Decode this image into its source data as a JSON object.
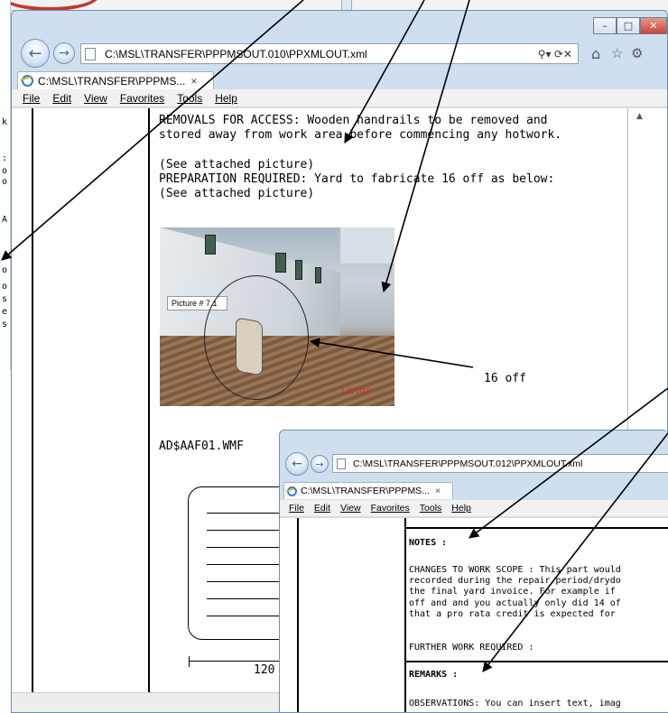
{
  "background": {
    "left_fragments": [
      "k",
      ":",
      "o",
      "o",
      "A",
      "o",
      "o",
      "s",
      "e",
      "s"
    ]
  },
  "window1": {
    "address": "C:\\MSL\\TRANSFER\\PPPMSOUT.010\\PPXMLOUT.xml",
    "search_icon": "search-dropdown-icon",
    "tab_title": "C:\\MSL\\TRANSFER\\PPPMS...",
    "tab_close": "×",
    "menu": [
      "File",
      "Edit",
      "View",
      "Favorites",
      "Tools",
      "Help"
    ],
    "doc_lines": [
      "REMOVALS FOR ACCESS: Wooden handrails to be removed and",
      "stored away from work area before commencing any hotwork.",
      "",
      "(See attached picture)",
      "PREPARATION REQUIRED: Yard to fabricate 16 off as below:",
      "(See attached picture)"
    ],
    "picture_label": "Picture # 7.1",
    "picture_date": "7 11 2007",
    "callout": "16 off",
    "image_filename": "AD$AAF01.WMF",
    "dimension_label": "120"
  },
  "window2": {
    "address": "C:\\MSL\\TRANSFER\\PPPMSOUT.012\\PPXMLOUT.xml",
    "tab_title": "C:\\MSL\\TRANSFER\\PPPMS...",
    "tab_close": "×",
    "menu": [
      "File",
      "Edit",
      "View",
      "Favorites",
      "Tools",
      "Help"
    ],
    "notes_heading": "NOTES :",
    "changes_lines": [
      "CHANGES TO WORK SCOPE : This part would",
      "recorded during the repair period/drydo",
      "the final yard invoice. For example if",
      "off and and you actually only did 14 of",
      "that a pro rata credit is expected for"
    ],
    "further_work": "FURTHER WORK REQUIRED :",
    "remarks_heading": "REMARKS :",
    "observations": "OBSERVATIONS: You can insert text, imag"
  },
  "colors": {
    "chrome": "#cfdff0",
    "close_button": "#c6453a",
    "picture_date": "#e0201a"
  }
}
